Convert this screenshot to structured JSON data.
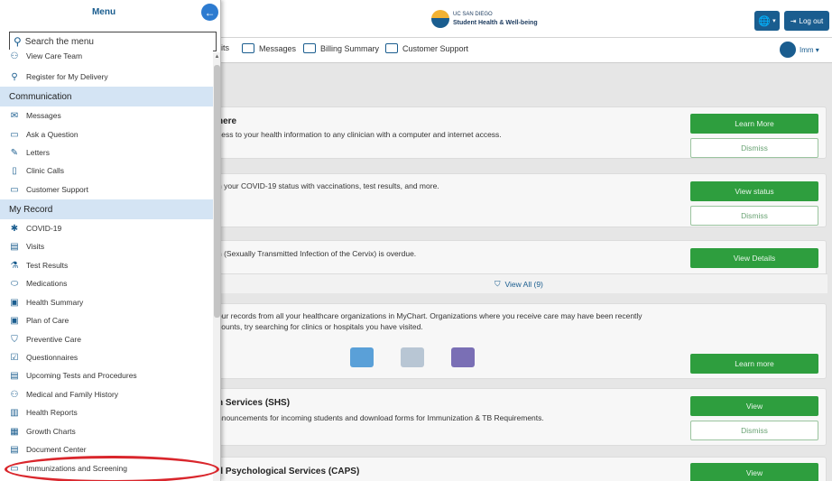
{
  "header": {
    "logo": {
      "line1": "UC SAN DIEGO",
      "line2": "Student Health & Well-being"
    },
    "globe_caret": "▾",
    "logout_label": "Log out"
  },
  "nav": {
    "items": [
      {
        "label": "its",
        "icon": ""
      },
      {
        "label": "Messages",
        "icon": "envelope-icon"
      },
      {
        "label": "Billing Summary",
        "icon": "billing-icon"
      },
      {
        "label": "Customer Support",
        "icon": "support-chat-icon"
      }
    ],
    "user_label": "Imm ▾"
  },
  "menu": {
    "title": "Menu",
    "search_placeholder": "Search the menu",
    "items": [
      {
        "type": "item",
        "label": "View Care Team",
        "icon": "care-team-icon"
      },
      {
        "type": "item",
        "label": "Register for My Delivery",
        "icon": "delivery-icon"
      },
      {
        "type": "section",
        "label": "Communication"
      },
      {
        "type": "item",
        "label": "Messages",
        "icon": "envelope-icon"
      },
      {
        "type": "item",
        "label": "Ask a Question",
        "icon": "question-chat-icon"
      },
      {
        "type": "item",
        "label": "Letters",
        "icon": "letter-icon"
      },
      {
        "type": "item",
        "label": "Clinic Calls",
        "icon": "phone-icon"
      },
      {
        "type": "item",
        "label": "Customer Support",
        "icon": "support-chat-icon"
      },
      {
        "type": "section",
        "label": "My Record"
      },
      {
        "type": "item",
        "label": "COVID-19",
        "icon": "virus-icon"
      },
      {
        "type": "item",
        "label": "Visits",
        "icon": "calendar-icon"
      },
      {
        "type": "item",
        "label": "Test Results",
        "icon": "flask-icon"
      },
      {
        "type": "item",
        "label": "Medications",
        "icon": "pill-icon"
      },
      {
        "type": "item",
        "label": "Health Summary",
        "icon": "heart-clipboard-icon"
      },
      {
        "type": "item",
        "label": "Plan of Care",
        "icon": "heart-clipboard-icon"
      },
      {
        "type": "item",
        "label": "Preventive Care",
        "icon": "shield-icon"
      },
      {
        "type": "item",
        "label": "Questionnaires",
        "icon": "checkbox-icon"
      },
      {
        "type": "item",
        "label": "Upcoming Tests and Procedures",
        "icon": "calendar-icon"
      },
      {
        "type": "item",
        "label": "Medical and Family History",
        "icon": "family-icon"
      },
      {
        "type": "item",
        "label": "Health Reports",
        "icon": "chart-icon"
      },
      {
        "type": "item",
        "label": "Growth Charts",
        "icon": "growth-chart-icon"
      },
      {
        "type": "item",
        "label": "Document Center",
        "icon": "document-icon"
      },
      {
        "type": "item",
        "label": "Immunizations and Screening",
        "icon": "syringe-icon"
      }
    ]
  },
  "cards": [
    {
      "title": "here",
      "text": "cess to your health information to any clinician with a computer and internet access.",
      "primary": "Learn More",
      "secondary": "Dismiss"
    },
    {
      "title": "",
      "text": "n your COVID-19 status with vaccinations, test results, and more.",
      "primary": "View status",
      "secondary": "Dismiss"
    },
    {
      "title": "",
      "text": "n (Sexually Transmitted Infection of the Cervix) is overdue.",
      "primary": "View Details",
      "view_all": "View All (9)"
    },
    {
      "title": "",
      "text1": "our records from all your healthcare organizations in MyChart. Organizations where you receive care may have been recently",
      "text2": "counts, try searching for clinics or hospitals you have visited.",
      "primary": "Learn more"
    },
    {
      "title": "h Services (SHS)",
      "text": "nnouncements for incoming students and download forms for Immunization & TB Requirements.",
      "primary": "View",
      "secondary": "Dismiss"
    },
    {
      "title": "d Psychological Services (CAPS)",
      "primary": "View"
    }
  ],
  "colors": {
    "accent": "#1a5d8f",
    "section_bg": "#d4e4f4",
    "green": "#2e9e3e",
    "annotation": "#d9262c"
  }
}
